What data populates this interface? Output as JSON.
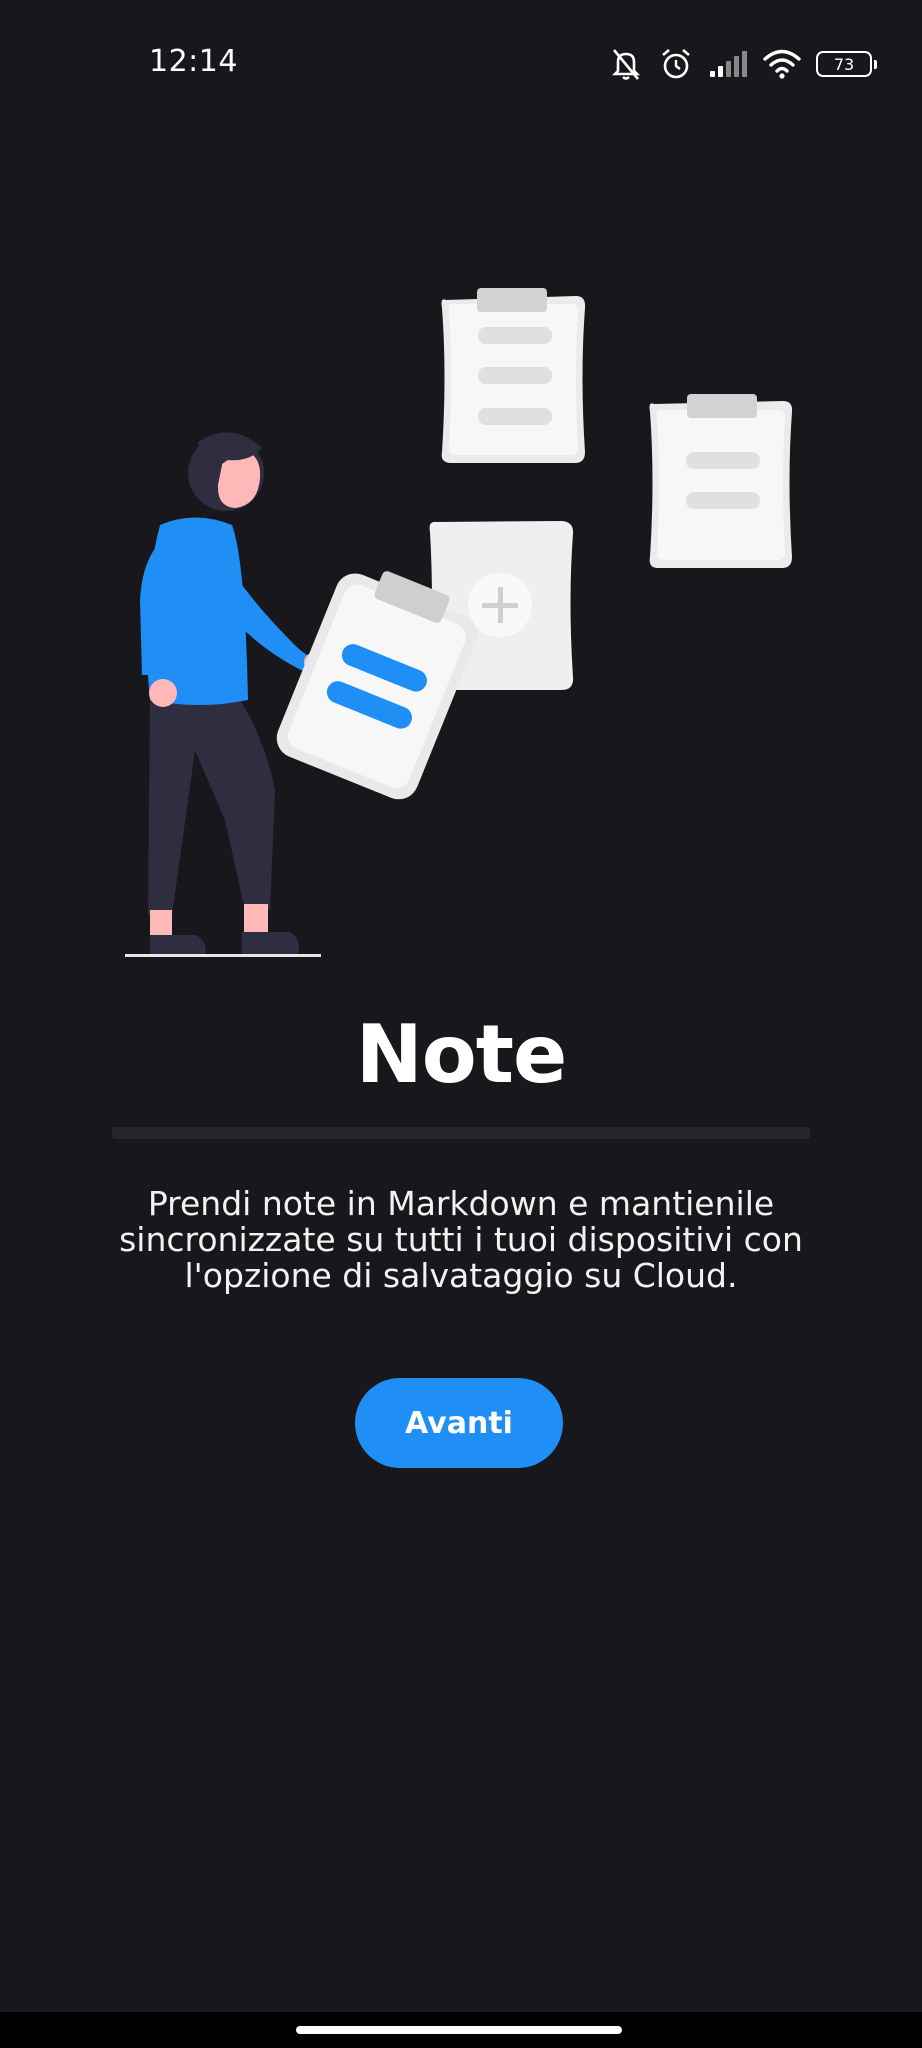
{
  "status_bar": {
    "time": "12:14",
    "battery_level": "73",
    "icons": [
      "muted-bell-icon",
      "alarm-icon",
      "signal-icon",
      "wifi-icon",
      "battery-icon"
    ]
  },
  "onboarding": {
    "title": "Note",
    "description": "Prendi note in Markdown e mantienile sincronizzate su tutti i tuoi dispositivi con l'opzione di salvataggio su Cloud.",
    "next_label": "Avanti"
  },
  "colors": {
    "background": "#18181c",
    "accent": "#1f8ff5",
    "text": "#ffffff"
  }
}
